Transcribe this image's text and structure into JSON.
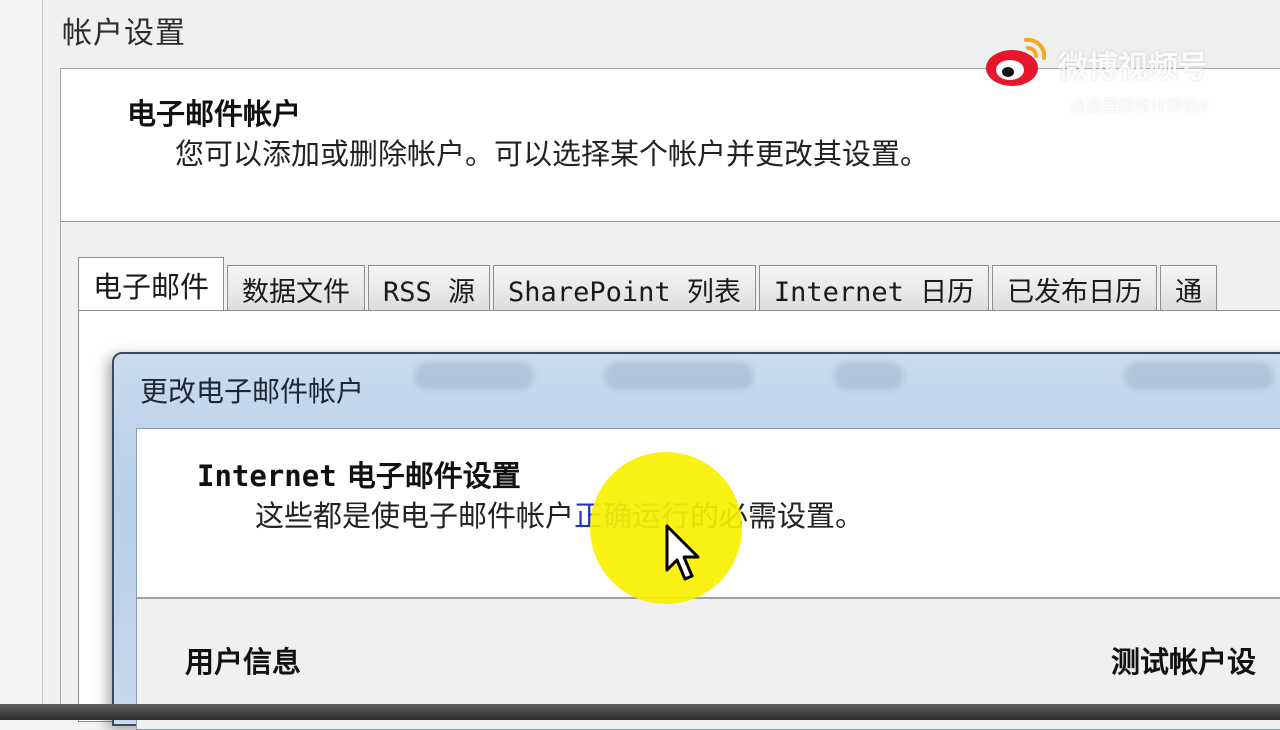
{
  "outer_window": {
    "title": "帐户设置",
    "heading": "电子邮件帐户",
    "description": "您可以添加或删除帐户。可以选择某个帐户并更改其设置。",
    "tabs": [
      {
        "label": "电子邮件",
        "active": true
      },
      {
        "label": "数据文件",
        "active": false
      },
      {
        "label": "RSS 源",
        "active": false
      },
      {
        "label": "SharePoint 列表",
        "active": false
      },
      {
        "label": "Internet 日历",
        "active": false
      },
      {
        "label": "已发布日历",
        "active": false
      },
      {
        "label": "通",
        "active": false
      }
    ]
  },
  "dialog": {
    "title": "更改电子邮件帐户",
    "heading_latin": "Internet",
    "heading_cjk": "电子邮件设置",
    "description_part1": "这些都是使电子邮件帐户",
    "description_highlight": "正确运行",
    "description_part2": "的必需设置。",
    "section_user_info": "用户信息",
    "section_test_account": "测试帐户设"
  },
  "watermark": {
    "brand": "微博视频号",
    "handle": "@远程维修计算机9"
  },
  "colors": {
    "link_highlight": "#1c36c8",
    "cursor_halo": "#f8f000",
    "dialog_titlebar": "#c0d5ec"
  }
}
